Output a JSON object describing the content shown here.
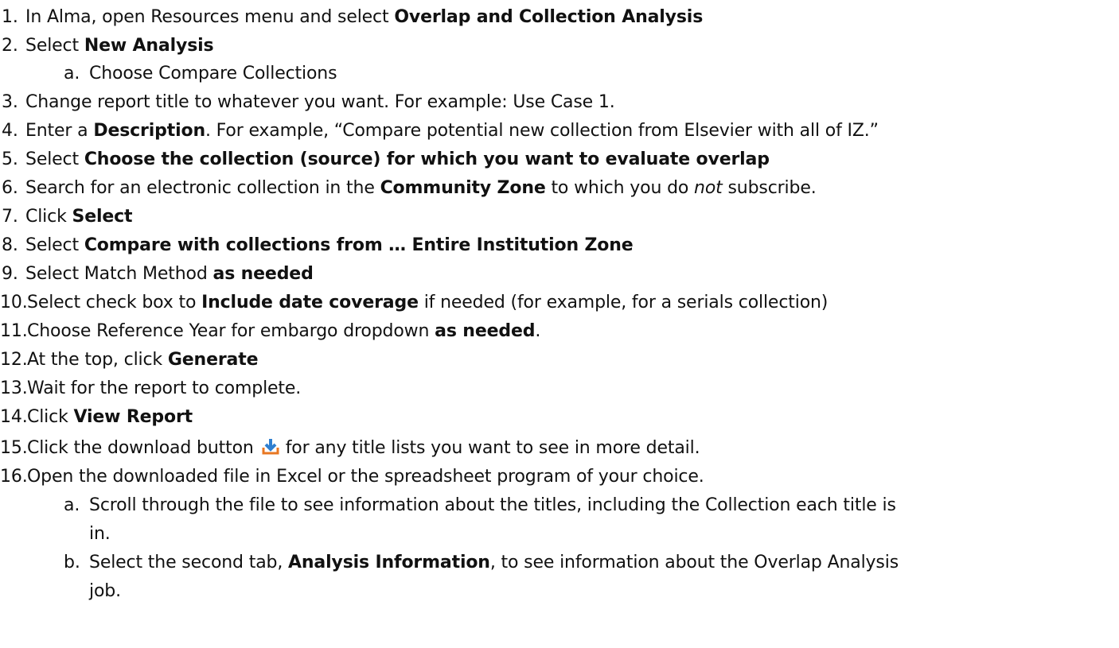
{
  "steps": [
    {
      "num": "1.",
      "parts": [
        "In Alma, open Resources menu and select ",
        "Overlap and Collection Analysis"
      ]
    },
    {
      "num": "2.",
      "parts": [
        "Select ",
        "New Analysis"
      ]
    },
    {
      "num": "a.",
      "parts": [
        "Choose Compare Collections"
      ]
    },
    {
      "num": "3.",
      "parts": [
        "Change report title to whatever you want. For example: Use Case 1."
      ]
    },
    {
      "num": "4.",
      "parts": [
        "Enter a ",
        "Description",
        ". For example, “Compare potential new collection from Elsevier with all of IZ.”"
      ]
    },
    {
      "num": "5.",
      "parts": [
        "Select ",
        "Choose the collection (source) for which you want to evaluate overlap"
      ]
    },
    {
      "num": "6.",
      "parts": [
        "Search for an electronic collection in the ",
        "Community Zone",
        " to which you do ",
        "not",
        " subscribe."
      ]
    },
    {
      "num": "7.",
      "parts": [
        "Click ",
        "Select"
      ]
    },
    {
      "num": "8.",
      "parts": [
        "Select ",
        "Compare with collections from … Entire Institution Zone"
      ]
    },
    {
      "num": "9.",
      "parts": [
        "Select Match Method ",
        "as needed"
      ]
    },
    {
      "num": "10.",
      "parts": [
        "Select check box to ",
        "Include date coverage",
        " if needed (for example, for a serials collection)"
      ]
    },
    {
      "num": "11.",
      "parts": [
        "Choose Reference Year for embargo dropdown ",
        "as needed",
        "."
      ]
    },
    {
      "num": "12.",
      "parts": [
        "At the top, click ",
        "Generate"
      ]
    },
    {
      "num": "13.",
      "parts": [
        "Wait for the report to complete."
      ]
    },
    {
      "num": "14.",
      "parts": [
        "Click ",
        "View Report"
      ]
    },
    {
      "num": "15.",
      "parts": [
        "Click the download button",
        "for any title lists you want to see in more detail."
      ]
    },
    {
      "num": "16.",
      "parts": [
        "Open the downloaded file in Excel or the spreadsheet program of your choice."
      ]
    },
    {
      "num": "a.",
      "parts": [
        "Scroll through the file to see information about the titles, including the Collection each title is",
        "in."
      ]
    },
    {
      "num": "b.",
      "parts": [
        "Select the second tab, ",
        "Analysis Information",
        ", to see information about the Overlap Analysis",
        "job."
      ]
    }
  ],
  "icons": {
    "download": "download-icon",
    "download_color": "#2f7fd0",
    "download_base_color": "#e87722"
  }
}
